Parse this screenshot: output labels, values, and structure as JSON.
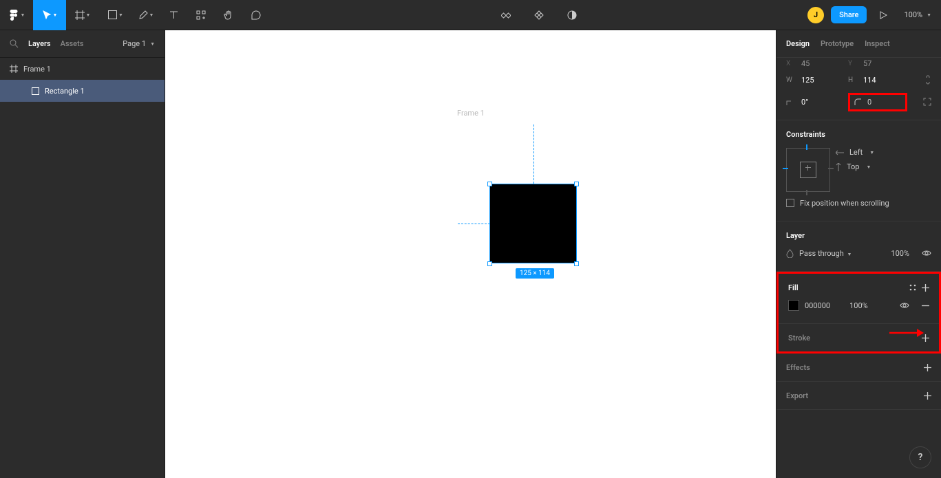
{
  "toolbar": {
    "avatar_initial": "J",
    "share_label": "Share",
    "zoom": "100%"
  },
  "left_panel": {
    "tabs": {
      "layers": "Layers",
      "assets": "Assets"
    },
    "page": "Page 1",
    "layers": [
      {
        "name": "Frame 1"
      },
      {
        "name": "Rectangle 1"
      }
    ]
  },
  "canvas": {
    "frame_label": "Frame 1",
    "dimensions_badge": "125 × 114"
  },
  "design": {
    "tabs": {
      "design": "Design",
      "prototype": "Prototype",
      "inspect": "Inspect"
    },
    "transform": {
      "x_label": "X",
      "x": "45",
      "y_label": "Y",
      "y": "57",
      "w_label": "W",
      "w": "125",
      "h_label": "H",
      "h": "114",
      "rotation_label": "",
      "rotation": "0°",
      "radius": "0"
    },
    "constraints": {
      "heading": "Constraints",
      "horizontal": "Left",
      "vertical": "Top",
      "fix_position": "Fix position when scrolling"
    },
    "layer": {
      "heading": "Layer",
      "blend": "Pass through",
      "opacity": "100%"
    },
    "fill": {
      "heading": "Fill",
      "hex": "000000",
      "opacity": "100%"
    },
    "stroke": {
      "heading": "Stroke"
    },
    "effects": {
      "heading": "Effects"
    },
    "export": {
      "heading": "Export"
    }
  }
}
